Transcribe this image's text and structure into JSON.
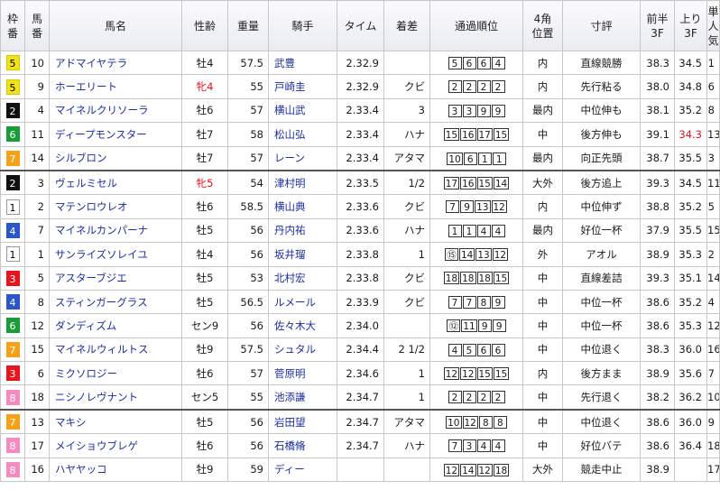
{
  "headers": {
    "waku": [
      "枠",
      "番"
    ],
    "umaban": [
      "馬",
      "番"
    ],
    "name": "馬名",
    "sex_age": "性齢",
    "weight": "重量",
    "jockey": "騎手",
    "time": "タイム",
    "margin": "着差",
    "passing": "通過順位",
    "corner4": [
      "4角",
      "位置"
    ],
    "comment": "寸評",
    "first3f": [
      "前半",
      "3F"
    ],
    "last3f": [
      "上り",
      "3F"
    ],
    "pop": [
      "単",
      "人",
      "気"
    ]
  },
  "frame_colors": {
    "1": "#ffffff",
    "2": "#111111",
    "3": "#e8141e",
    "4": "#2b56c8",
    "5": "#f2e21a",
    "6": "#1a9c3a",
    "7": "#f6a11a",
    "8": "#f58cc0"
  },
  "rows": [
    {
      "waku": "5",
      "umaban": "10",
      "name": "アドマイヤテラ",
      "sex_age": "牡4",
      "sex_red": false,
      "weight": "57.5",
      "jockey": "武豊",
      "time": "2.32.9",
      "margin": "",
      "passing": [
        "5",
        "6",
        "6",
        "4"
      ],
      "corner4": "内",
      "comment": "直線競勝",
      "first3f": "38.3",
      "last3f": "34.5",
      "last3f_red": false,
      "pop": "1"
    },
    {
      "waku": "5",
      "umaban": "9",
      "name": "ホーエリート",
      "sex_age": "牝4",
      "sex_red": true,
      "weight": "55",
      "jockey": "戸崎圭",
      "time": "2.32.9",
      "margin": "クビ",
      "passing": [
        "2",
        "2",
        "2",
        "2"
      ],
      "corner4": "内",
      "comment": "先行粘る",
      "first3f": "38.0",
      "last3f": "34.8",
      "last3f_red": false,
      "pop": "6"
    },
    {
      "waku": "2",
      "umaban": "4",
      "name": "マイネルクリソーラ",
      "sex_age": "牡6",
      "sex_red": false,
      "weight": "57",
      "jockey": "横山武",
      "time": "2.33.4",
      "margin": "3",
      "passing": [
        "3",
        "3",
        "9",
        "9"
      ],
      "corner4": "最内",
      "comment": "中位伸も",
      "first3f": "38.1",
      "last3f": "35.2",
      "last3f_red": false,
      "pop": "8"
    },
    {
      "waku": "6",
      "umaban": "11",
      "name": "ディープモンスター",
      "sex_age": "牡7",
      "sex_red": false,
      "weight": "58",
      "jockey": "松山弘",
      "time": "2.33.4",
      "margin": "ハナ",
      "passing": [
        "15",
        "16",
        "17",
        "15"
      ],
      "corner4": "中",
      "comment": "後方伸も",
      "first3f": "39.1",
      "last3f": "34.3",
      "last3f_red": true,
      "pop": "13"
    },
    {
      "waku": "7",
      "umaban": "14",
      "name": "シルブロン",
      "sex_age": "牡7",
      "sex_red": false,
      "weight": "57",
      "jockey": "レーン",
      "time": "2.33.4",
      "margin": "アタマ",
      "passing": [
        "10",
        "6",
        "1",
        "1"
      ],
      "corner4": "最内",
      "comment": "向正先頭",
      "first3f": "38.7",
      "last3f": "35.5",
      "last3f_red": false,
      "pop": "3"
    },
    {
      "waku": "2",
      "umaban": "3",
      "name": "ヴェルミセル",
      "sex_age": "牝5",
      "sex_red": true,
      "weight": "54",
      "jockey": "津村明",
      "time": "2.33.5",
      "margin": "1/2",
      "passing": [
        "17",
        "16",
        "15",
        "14"
      ],
      "corner4": "大外",
      "comment": "後方追上",
      "first3f": "39.3",
      "last3f": "34.5",
      "last3f_red": false,
      "pop": "11",
      "sep": true
    },
    {
      "waku": "1",
      "umaban": "2",
      "name": "マテンロウレオ",
      "sex_age": "牡6",
      "sex_red": false,
      "weight": "58.5",
      "jockey": "横山典",
      "time": "2.33.6",
      "margin": "クビ",
      "passing": [
        "7",
        "9",
        "13",
        "12"
      ],
      "corner4": "内",
      "comment": "中位伸ず",
      "first3f": "38.8",
      "last3f": "35.2",
      "last3f_red": false,
      "pop": "5"
    },
    {
      "waku": "4",
      "umaban": "7",
      "name": "マイネルカンパーナ",
      "sex_age": "牡5",
      "sex_red": false,
      "weight": "56",
      "jockey": "丹内祐",
      "time": "2.33.6",
      "margin": "ハナ",
      "passing": [
        "1",
        "1",
        "4",
        "4"
      ],
      "corner4": "最内",
      "comment": "好位一杯",
      "first3f": "37.9",
      "last3f": "35.5",
      "last3f_red": false,
      "pop": "15"
    },
    {
      "waku": "1",
      "umaban": "1",
      "name": "サンライズソレイユ",
      "sex_age": "牡4",
      "sex_red": false,
      "weight": "56",
      "jockey": "坂井瑠",
      "time": "2.33.8",
      "margin": "1",
      "passing": [
        "⑮",
        "14",
        "13",
        "12"
      ],
      "corner4": "外",
      "comment": "アオル",
      "first3f": "38.9",
      "last3f": "35.3",
      "last3f_red": false,
      "pop": "2"
    },
    {
      "waku": "3",
      "umaban": "5",
      "name": "アスターブジエ",
      "sex_age": "牡5",
      "sex_red": false,
      "weight": "53",
      "jockey": "北村宏",
      "time": "2.33.8",
      "margin": "クビ",
      "passing": [
        "18",
        "18",
        "18",
        "15"
      ],
      "corner4": "中",
      "comment": "直線差詰",
      "first3f": "39.3",
      "last3f": "35.1",
      "last3f_red": false,
      "pop": "14"
    },
    {
      "waku": "4",
      "umaban": "8",
      "name": "スティンガーグラス",
      "sex_age": "牡5",
      "sex_red": false,
      "weight": "56.5",
      "jockey": "ルメール",
      "time": "2.33.9",
      "margin": "クビ",
      "passing": [
        "7",
        "7",
        "8",
        "9"
      ],
      "corner4": "中",
      "comment": "中位一杯",
      "first3f": "38.6",
      "last3f": "35.2",
      "last3f_red": false,
      "pop": "4"
    },
    {
      "waku": "6",
      "umaban": "12",
      "name": "ダンディズム",
      "sex_age": "セン9",
      "sex_red": false,
      "weight": "56",
      "jockey": "佐々木大",
      "time": "2.34.0",
      "margin": "",
      "passing": [
        "⑫",
        "11",
        "9",
        "9"
      ],
      "corner4": "中",
      "comment": "中位一杯",
      "first3f": "38.6",
      "last3f": "35.3",
      "last3f_red": false,
      "pop": "12"
    },
    {
      "waku": "7",
      "umaban": "15",
      "name": "マイネルウィルトス",
      "sex_age": "牡9",
      "sex_red": false,
      "weight": "57.5",
      "jockey": "シュタル",
      "time": "2.34.4",
      "margin": "2 1/2",
      "passing": [
        "4",
        "5",
        "6",
        "6"
      ],
      "corner4": "中",
      "comment": "中位退く",
      "first3f": "38.3",
      "last3f": "36.0",
      "last3f_red": false,
      "pop": "16"
    },
    {
      "waku": "3",
      "umaban": "6",
      "name": "ミクソロジー",
      "sex_age": "牡6",
      "sex_red": false,
      "weight": "57",
      "jockey": "菅原明",
      "time": "2.34.6",
      "margin": "1",
      "passing": [
        "12",
        "12",
        "15",
        "15"
      ],
      "corner4": "内",
      "comment": "後方まま",
      "first3f": "38.9",
      "last3f": "35.6",
      "last3f_red": false,
      "pop": "7"
    },
    {
      "waku": "8",
      "umaban": "18",
      "name": "ニシノレヴナント",
      "sex_age": "セン5",
      "sex_red": false,
      "weight": "55",
      "jockey": "池添謙",
      "time": "2.34.7",
      "margin": "1",
      "passing": [
        "2",
        "2",
        "2",
        "2"
      ],
      "corner4": "中",
      "comment": "先行退く",
      "first3f": "38.2",
      "last3f": "36.2",
      "last3f_red": false,
      "pop": "10"
    },
    {
      "waku": "7",
      "umaban": "13",
      "name": "マキシ",
      "sex_age": "牡5",
      "sex_red": false,
      "weight": "56",
      "jockey": "岩田望",
      "time": "2.34.7",
      "margin": "アタマ",
      "passing": [
        "10",
        "12",
        "8",
        "8"
      ],
      "corner4": "中",
      "comment": "中位退く",
      "first3f": "38.6",
      "last3f": "36.0",
      "last3f_red": false,
      "pop": "9",
      "sep": true
    },
    {
      "waku": "8",
      "umaban": "17",
      "name": "メイショウブレゲ",
      "sex_age": "牡6",
      "sex_red": false,
      "weight": "56",
      "jockey": "石橋脩",
      "time": "2.34.7",
      "margin": "ハナ",
      "passing": [
        "7",
        "3",
        "4",
        "4"
      ],
      "corner4": "中",
      "comment": "好位バテ",
      "first3f": "38.6",
      "last3f": "36.4",
      "last3f_red": false,
      "pop": "18"
    },
    {
      "waku": "8",
      "umaban": "16",
      "name": "ハヤヤッコ",
      "sex_age": "牡9",
      "sex_red": false,
      "weight": "59",
      "jockey": "ディー",
      "time": "",
      "margin": "",
      "passing": [
        "12",
        "14",
        "12",
        "18"
      ],
      "corner4": "大外",
      "comment": "競走中止",
      "first3f": "38.9",
      "last3f": "",
      "last3f_red": false,
      "pop": "17"
    }
  ]
}
